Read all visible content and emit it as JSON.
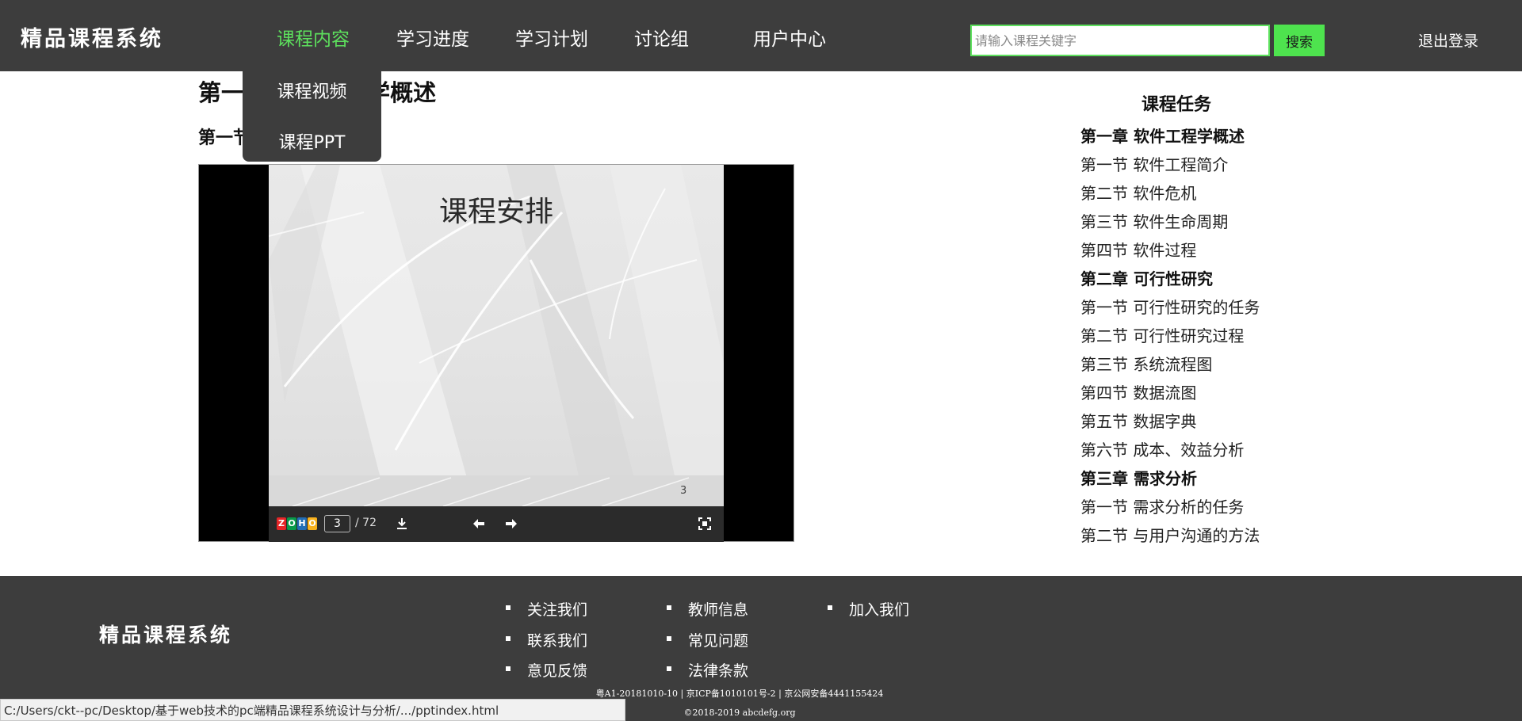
{
  "header": {
    "logo": "精品课程系统",
    "nav": [
      "课程内容",
      "学习进度",
      "学习计划",
      "讨论组",
      "用户中心"
    ],
    "search_placeholder": "请输入课程关键字",
    "search_button": "搜索",
    "logout": "退出登录"
  },
  "dropdown": {
    "items": [
      "课程视频",
      "课程PPT"
    ]
  },
  "main": {
    "chapter_title": "第一章 软件工程学概述",
    "section_title": "第一节 软件工程简介"
  },
  "viewer": {
    "slide_title": "课程安排",
    "slide_number": "3",
    "current_page": "3",
    "total_pages": "/ 72",
    "brand": [
      "Z",
      "O",
      "H",
      "O"
    ],
    "brand_colors": [
      "#e42527",
      "#089949",
      "#226db4",
      "#f9b21d"
    ]
  },
  "sidebar": {
    "title": "课程任务",
    "items": [
      {
        "label": "第一章 软件工程学概述",
        "chapter": true
      },
      {
        "label": "第一节 软件工程简介",
        "chapter": false
      },
      {
        "label": "第二节 软件危机",
        "chapter": false
      },
      {
        "label": "第三节 软件生命周期",
        "chapter": false
      },
      {
        "label": "第四节 软件过程",
        "chapter": false
      },
      {
        "label": "第二章 可行性研究",
        "chapter": true
      },
      {
        "label": "第一节 可行性研究的任务",
        "chapter": false
      },
      {
        "label": "第二节 可行性研究过程",
        "chapter": false
      },
      {
        "label": "第三节 系统流程图",
        "chapter": false
      },
      {
        "label": "第四节 数据流图",
        "chapter": false
      },
      {
        "label": "第五节 数据字典",
        "chapter": false
      },
      {
        "label": "第六节 成本、效益分析",
        "chapter": false
      },
      {
        "label": "第三章 需求分析",
        "chapter": true
      },
      {
        "label": "第一节 需求分析的任务",
        "chapter": false
      },
      {
        "label": "第二节 与用户沟通的方法",
        "chapter": false
      }
    ]
  },
  "footer": {
    "logo": "精品课程系统",
    "links": [
      "关注我们",
      "教师信息",
      "加入我们",
      "联系我们",
      "常见问题",
      "意见反馈",
      "法律条款"
    ],
    "legal": "粤A1-20181010-10 | 京ICP备1010101号-2 | 京公网安备4441155424",
    "copyright": "©2018-2019 abcdefg.org"
  },
  "status_bar": "C:/Users/ckt--pc/Desktop/基于web技术的pc端精品课程系统设计与分析/.../pptindex.html",
  "colors": {
    "accent": "#5de05d",
    "header_bg": "#3d3d3d",
    "footer_bg": "#3d3d3d"
  }
}
